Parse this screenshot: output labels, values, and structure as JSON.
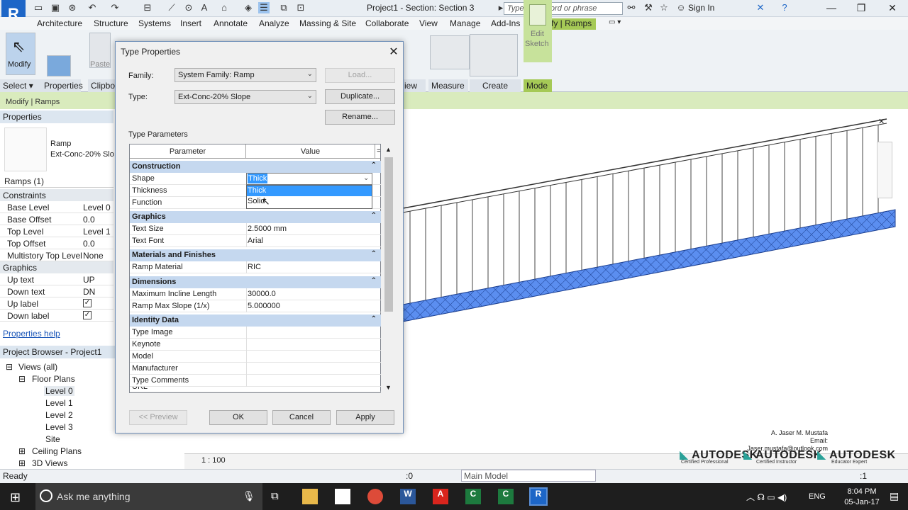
{
  "window": {
    "title": "Project1 - Section: Section 3",
    "search_placeholder": "Type a keyword or phrase",
    "sign_in": "Sign In",
    "logo": "R"
  },
  "ribbon": {
    "tabs": [
      "Architecture",
      "Structure",
      "Systems",
      "Insert",
      "Annotate",
      "Analyze",
      "Massing & Site",
      "Collaborate",
      "View",
      "Manage",
      "Add-Ins",
      "Modify | Ramps"
    ],
    "buttons": {
      "modify": "Modify",
      "paste": "Paste",
      "edit_sketch_1": "Edit",
      "edit_sketch_2": "Sketch"
    },
    "panels": {
      "select": "Select",
      "properties": "Properties",
      "clipboard": "Clipbo",
      "view": "iew",
      "measure": "Measure",
      "create": "Create",
      "mode": "Mode"
    },
    "context_label": "Modify | Ramps"
  },
  "properties_panel": {
    "title": "Properties",
    "type_name_1": "Ramp",
    "type_name_2": "Ext-Conc-20% Slo",
    "instance_filter": "Ramps (1)",
    "sections": {
      "constraints": "Constraints",
      "graphics": "Graphics"
    },
    "rows": [
      {
        "key": "Base Level",
        "value": "Level 0"
      },
      {
        "key": "Base Offset",
        "value": "0.0"
      },
      {
        "key": "Top Level",
        "value": "Level 1"
      },
      {
        "key": "Top Offset",
        "value": "0.0"
      },
      {
        "key": "Multistory Top Level",
        "value": "None"
      }
    ],
    "graphics_rows": [
      {
        "key": "Up text",
        "value": "UP"
      },
      {
        "key": "Down text",
        "value": "DN"
      },
      {
        "key": "Up label",
        "value": "✓"
      },
      {
        "key": "Down label",
        "value": "✓"
      }
    ],
    "help_link": "Properties help"
  },
  "project_browser": {
    "title": "Project Browser - Project1",
    "views_all": "Views (all)",
    "floor_plans": "Floor Plans",
    "levels": [
      "Level 0",
      "Level 1",
      "Level 2",
      "Level 3",
      "Site"
    ],
    "ceiling_plans": "Ceiling Plans",
    "views_3d": "3D Views"
  },
  "view_control": {
    "scale": "1 : 100"
  },
  "status_bar": {
    "ready": "Ready",
    "selection_count": ":0",
    "model": "Main Model",
    "filter_count": ":1"
  },
  "dialog": {
    "title": "Type Properties",
    "family_label": "Family:",
    "family_value": "System Family: Ramp",
    "type_label": "Type:",
    "type_value": "Ext-Conc-20% Slope",
    "load": "Load...",
    "duplicate": "Duplicate...",
    "rename": "Rename...",
    "type_parameters": "Type Parameters",
    "col_parameter": "Parameter",
    "col_value": "Value",
    "sections": [
      {
        "name": "Construction",
        "rows": [
          {
            "key": "Shape",
            "value": "Thick"
          },
          {
            "key": "Thickness",
            "value": ""
          },
          {
            "key": "Function",
            "value": ""
          }
        ]
      },
      {
        "name": "Graphics",
        "rows": [
          {
            "key": "Text Size",
            "value": "2.5000 mm"
          },
          {
            "key": "Text Font",
            "value": "Arial"
          }
        ]
      },
      {
        "name": "Materials and Finishes",
        "rows": [
          {
            "key": "Ramp Material",
            "value": "RIC"
          }
        ]
      },
      {
        "name": "Dimensions",
        "rows": [
          {
            "key": "Maximum Incline Length",
            "value": "30000.0"
          },
          {
            "key": "Ramp Max Slope (1/x)",
            "value": "5.000000"
          }
        ]
      },
      {
        "name": "Identity Data",
        "rows": [
          {
            "key": "Type Image",
            "value": ""
          },
          {
            "key": "Keynote",
            "value": ""
          },
          {
            "key": "Model",
            "value": ""
          },
          {
            "key": "Manufacturer",
            "value": ""
          },
          {
            "key": "Type Comments",
            "value": ""
          },
          {
            "key": "URL",
            "value": ""
          }
        ]
      }
    ],
    "dropdown_options": [
      "Thick",
      "Solid"
    ],
    "preview": "<< Preview",
    "ok": "OK",
    "cancel": "Cancel",
    "apply": "Apply"
  },
  "watermark": {
    "author": "A. Jaser M. Mustafa",
    "email": "Email: Jaser.mustafa@outlook.com",
    "brand": "AUTODESK",
    "certs": [
      "Certified Professional",
      "Certified Instructor",
      "Educator Expert"
    ]
  },
  "taskbar": {
    "cortana": "Ask me anything",
    "lang": "ENG",
    "time": "8:04 PM",
    "date": "05-Jan-17"
  },
  "colors": {
    "ribbon_active": "#a5c956",
    "ramp_fill": "#5b8ef0",
    "section_header": "#c5d8ef",
    "selection": "#3399ff"
  }
}
